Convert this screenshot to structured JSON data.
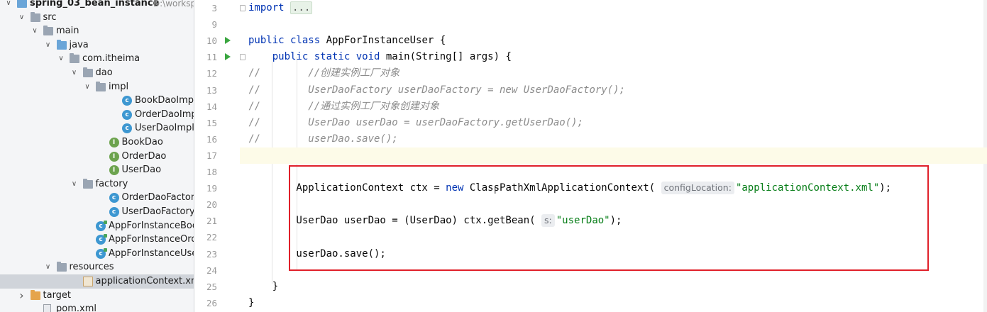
{
  "project_tree": {
    "items": [
      {
        "label": "spring_03_bean_instance",
        "path": "D:\\workspace",
        "kind": "folder-blue",
        "arrow": "open",
        "indent": 0,
        "bold": true
      },
      {
        "label": "src",
        "kind": "folder",
        "arrow": "open",
        "indent": 1
      },
      {
        "label": "main",
        "kind": "folder",
        "arrow": "open",
        "indent": 2
      },
      {
        "label": "java",
        "kind": "folder-blue",
        "arrow": "open",
        "indent": 3
      },
      {
        "label": "com.itheima",
        "kind": "folder",
        "arrow": "open",
        "indent": 4
      },
      {
        "label": "dao",
        "kind": "folder",
        "arrow": "open",
        "indent": 5
      },
      {
        "label": "impl",
        "kind": "folder",
        "arrow": "open",
        "indent": 6
      },
      {
        "label": "BookDaoImpl",
        "kind": "class",
        "indent": 8
      },
      {
        "label": "OrderDaoImpl",
        "kind": "class",
        "indent": 8
      },
      {
        "label": "UserDaoImpl",
        "kind": "class",
        "indent": 8
      },
      {
        "label": "BookDao",
        "kind": "interface",
        "indent": 7
      },
      {
        "label": "OrderDao",
        "kind": "interface",
        "indent": 7
      },
      {
        "label": "UserDao",
        "kind": "interface",
        "indent": 7
      },
      {
        "label": "factory",
        "kind": "folder",
        "arrow": "open",
        "indent": 5
      },
      {
        "label": "OrderDaoFactory",
        "kind": "class",
        "indent": 7
      },
      {
        "label": "UserDaoFactory",
        "kind": "class",
        "indent": 7
      },
      {
        "label": "AppForInstanceBook",
        "kind": "main-class",
        "indent": 6
      },
      {
        "label": "AppForInstanceOrder",
        "kind": "main-class",
        "indent": 6
      },
      {
        "label": "AppForInstanceUser",
        "kind": "main-class",
        "indent": 6
      },
      {
        "label": "resources",
        "kind": "folder",
        "arrow": "open",
        "indent": 3
      },
      {
        "label": "applicationContext.xml",
        "kind": "xml",
        "indent": 5,
        "selected": true
      },
      {
        "label": "target",
        "kind": "folder-orange",
        "arrow": "closed",
        "indent": 1
      },
      {
        "label": "pom.xml",
        "kind": "file",
        "indent": 2
      }
    ]
  },
  "editor": {
    "lines": [
      {
        "num": "3",
        "tokens": [
          {
            "t": "import ",
            "c": "kw"
          },
          {
            "t": "...",
            "c": "fold"
          }
        ]
      },
      {
        "num": "9",
        "tokens": []
      },
      {
        "num": "10",
        "run": true,
        "tokens": [
          {
            "t": "public class ",
            "c": "kw"
          },
          {
            "t": "AppForInstanceUser {"
          }
        ]
      },
      {
        "num": "11",
        "run": true,
        "fold": true,
        "tokens": [
          {
            "t": "    "
          },
          {
            "t": "public static void ",
            "c": "kw"
          },
          {
            "t": "main(String[] args) {"
          }
        ]
      },
      {
        "num": "12",
        "tokens": [
          {
            "t": "//",
            "c": "cmtmark"
          },
          {
            "t": "        //创建实例工厂对象",
            "c": "cmt"
          }
        ]
      },
      {
        "num": "13",
        "tokens": [
          {
            "t": "//",
            "c": "cmtmark"
          },
          {
            "t": "        UserDaoFactory userDaoFactory = new UserDaoFactory();",
            "c": "cmt"
          }
        ]
      },
      {
        "num": "14",
        "tokens": [
          {
            "t": "//",
            "c": "cmtmark"
          },
          {
            "t": "        //通过实例工厂对象创建对象",
            "c": "cmt"
          }
        ]
      },
      {
        "num": "15",
        "tokens": [
          {
            "t": "//",
            "c": "cmtmark"
          },
          {
            "t": "        UserDao userDao = userDaoFactory.getUserDao();",
            "c": "cmt"
          }
        ]
      },
      {
        "num": "16",
        "tokens": [
          {
            "t": "//",
            "c": "cmtmark"
          },
          {
            "t": "        userDao.save();",
            "c": "cmt"
          }
        ]
      },
      {
        "num": "17",
        "current": true,
        "tokens": []
      },
      {
        "num": "18",
        "tokens": []
      },
      {
        "num": "19",
        "tokens": [
          {
            "t": "        ApplicationContext ctx = "
          },
          {
            "t": "new ",
            "c": "kw"
          },
          {
            "t": "ClassPathXmlApplicationContext( "
          },
          {
            "t": "configLocation:",
            "c": "hint"
          },
          {
            "t": "\"applicationContext.xml\"",
            "c": "str"
          },
          {
            "t": ");"
          }
        ]
      },
      {
        "num": "20",
        "tokens": []
      },
      {
        "num": "21",
        "tokens": [
          {
            "t": "        UserDao userDao = (UserDao) ctx.getBean( "
          },
          {
            "t": "s:",
            "c": "hint"
          },
          {
            "t": "\"userDao\"",
            "c": "str"
          },
          {
            "t": ");"
          }
        ]
      },
      {
        "num": "22",
        "tokens": []
      },
      {
        "num": "23",
        "tokens": [
          {
            "t": "        userDao.save();"
          }
        ]
      },
      {
        "num": "24",
        "tokens": []
      },
      {
        "num": "25",
        "tokens": [
          {
            "t": "    }"
          }
        ]
      },
      {
        "num": "26",
        "tokens": [
          {
            "t": "}"
          }
        ]
      }
    ]
  },
  "colors": {
    "keyword": "#0033b3",
    "string": "#067d17",
    "comment": "#8c8c8c",
    "highlight_box": "#e0202a",
    "run_icon": "#3aa640"
  }
}
